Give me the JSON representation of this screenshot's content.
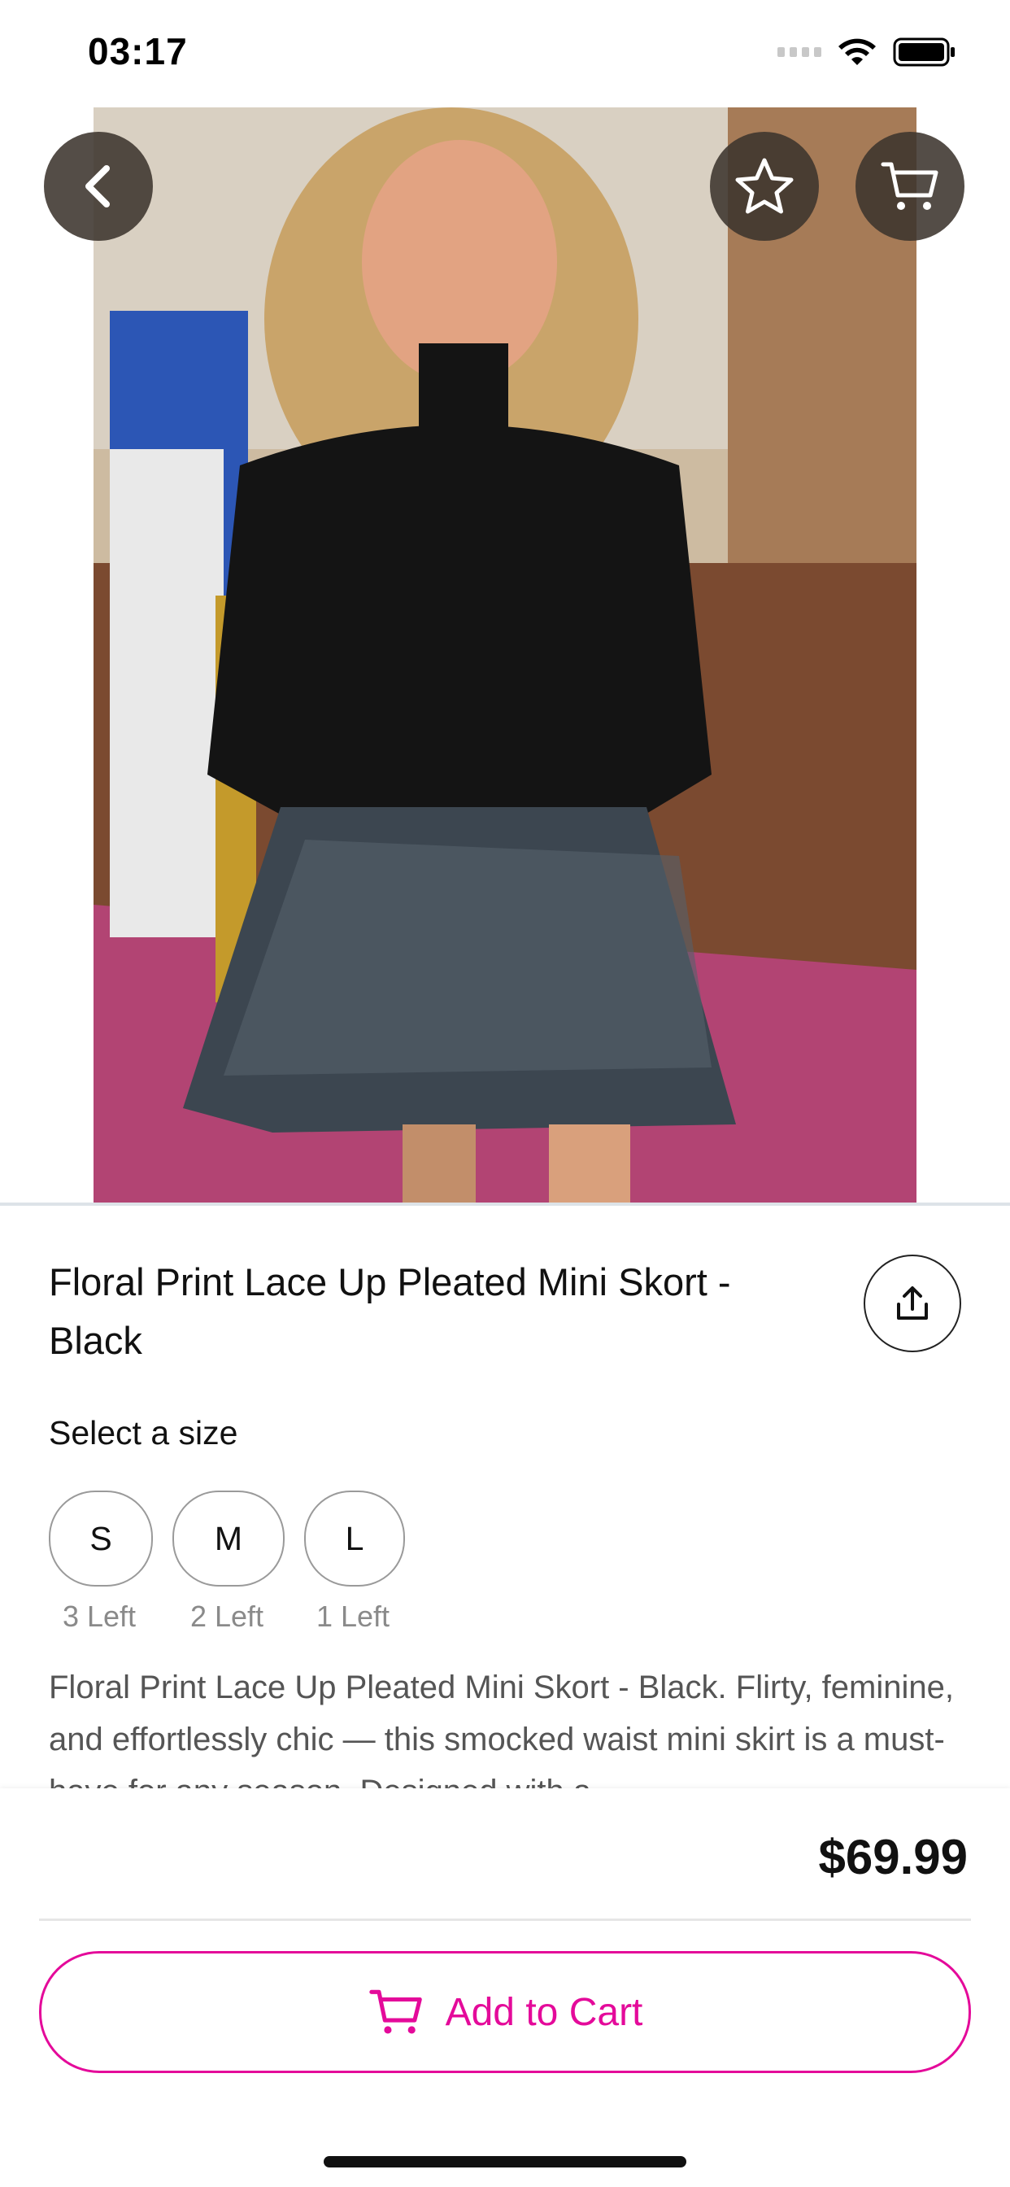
{
  "status_bar": {
    "time": "03:17",
    "icons": [
      "signal-icon",
      "wifi-icon",
      "battery-icon"
    ]
  },
  "header_buttons": {
    "back": "chevron-left-icon",
    "favorite": "star-icon",
    "cart": "cart-icon"
  },
  "gallery": {
    "image": "product-photo",
    "page_count": 2,
    "active_index": 1
  },
  "product": {
    "title": "Floral Print Lace Up Pleated Mini Skort - Black",
    "share_icon": "share-icon",
    "size_label": "Select a size",
    "sizes": [
      {
        "label": "S",
        "stock": "3 Left"
      },
      {
        "label": "M",
        "stock": "2 Left"
      },
      {
        "label": "L",
        "stock": "1 Left"
      }
    ],
    "description": "Floral Print Lace Up Pleated Mini Skort - Black. Flirty, feminine, and effortlessly chic — this smocked waist mini skirt is a must-have for any season. Designed with a"
  },
  "footer": {
    "price": "$69.99",
    "add_to_cart": "Add to Cart",
    "cart_icon": "cart-icon"
  },
  "colors": {
    "accent": "#e40a9a",
    "button_overlay": "#3c342e"
  }
}
